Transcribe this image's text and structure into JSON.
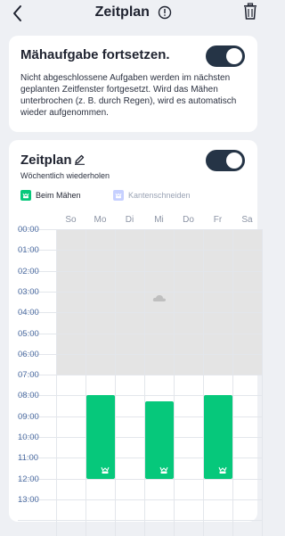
{
  "header": {
    "title": "Zeitplan",
    "back_icon": "chevron-left-icon",
    "info_icon": "info-circle-icon",
    "delete_icon": "trash-icon"
  },
  "resume_card": {
    "title": "Mähaufgabe fortsetzen.",
    "toggle_on": true,
    "description": "Nicht abgeschlossene Aufgaben werden im nächsten geplanten Zeitfenster fortgesetzt. Wird das Mähen unterbrochen (z. B. durch Regen), wird es automatisch wieder aufgenommen."
  },
  "schedule_card": {
    "title": "Zeitplan",
    "subtitle": "Wöchentlich wiederholen",
    "toggle_on": true,
    "legend": [
      {
        "label": "Beim Mähen",
        "color": "#06c87b",
        "active": true
      },
      {
        "label": "Kantenschneiden",
        "color": "#c6d0ff",
        "active": false
      }
    ],
    "days": [
      "So",
      "Mo",
      "Di",
      "Mi",
      "Do",
      "Fr",
      "Sa"
    ],
    "hours": [
      "00:00",
      "01:00",
      "02:00",
      "03:00",
      "04:00",
      "05:00",
      "06:00",
      "07:00",
      "08:00",
      "09:00",
      "10:00",
      "11:00",
      "12:00",
      "13:00"
    ],
    "disabled_until_hour": 7,
    "slots": [
      {
        "day": "Mo",
        "start": 8.0,
        "end": 12.0
      },
      {
        "day": "Mi",
        "start": 8.3,
        "end": 12.0
      },
      {
        "day": "Fr",
        "start": 8.0,
        "end": 12.0
      }
    ]
  },
  "colors": {
    "accent": "#06c87b",
    "toggle": "#253446",
    "disabled_area": "#e4e4e4",
    "background": "#eef0f4"
  }
}
